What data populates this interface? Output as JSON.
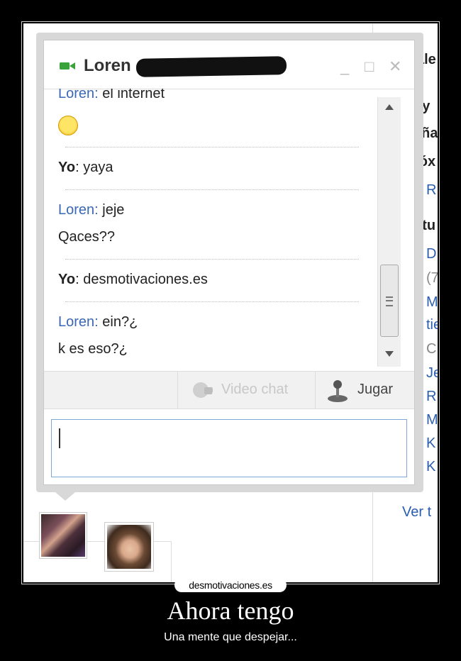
{
  "chat": {
    "contact_name": "Loren",
    "window_controls": [
      "_",
      "□",
      "✕"
    ],
    "messages": [
      {
        "sender": "Loren",
        "text": "el internet"
      },
      {
        "sender": "Yo",
        "text": "yaya"
      },
      {
        "sender": "Loren",
        "text": "jeje"
      },
      {
        "sender": "",
        "text": "Qaces??"
      },
      {
        "sender": "Yo",
        "text": "desmotivaciones.es"
      },
      {
        "sender": "Loren",
        "text": "ein?¿"
      },
      {
        "sender": "",
        "text": "k es eso?¿"
      }
    ],
    "sender_sep": ":",
    "toolbar": {
      "video_label": "Video chat",
      "jugar_label": "Jugar"
    },
    "input_value": ""
  },
  "background_page": {
    "lines": [
      {
        "text": "ale",
        "kind": "heading"
      },
      {
        "text": "oy",
        "kind": "heading"
      },
      {
        "text": "aña",
        "kind": "heading"
      },
      {
        "text": "róx",
        "kind": "heading"
      },
      {
        "text": "R",
        "kind": "link"
      },
      {
        "text": "utu",
        "kind": "heading"
      },
      {
        "text": "D",
        "kind": "link"
      },
      {
        "text": "(7",
        "kind": "gray"
      },
      {
        "text": "M",
        "kind": "link"
      },
      {
        "text": "tie",
        "kind": "link"
      },
      {
        "text": "C",
        "kind": "gray"
      },
      {
        "text": "Je",
        "kind": "link"
      },
      {
        "text": "R",
        "kind": "link"
      },
      {
        "text": "M",
        "kind": "link"
      },
      {
        "text": "K",
        "kind": "link"
      },
      {
        "text": "K",
        "kind": "link"
      }
    ],
    "ver_link": "Ver t"
  },
  "caption": {
    "site": "desmotivaciones.es",
    "headline": "Ahora tengo",
    "subline": "Una mente que despejar..."
  },
  "colors": {
    "link_blue": "#2a5db0",
    "sender_blue": "#3b68b5",
    "camera_green": "#3aa23a",
    "input_border": "#7ea6d6"
  }
}
